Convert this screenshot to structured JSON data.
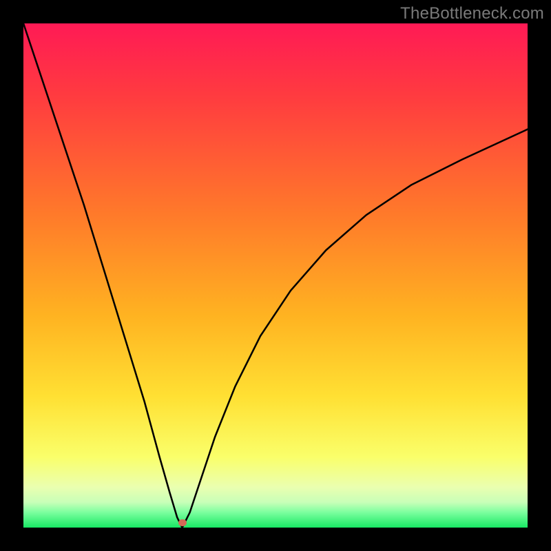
{
  "watermark": "TheBottleneck.com",
  "marker": {
    "x_pct": 31.5,
    "y_pct": 99.0,
    "color": "#d46a57"
  },
  "gradient_stops": [
    {
      "pct": 0,
      "color": "#ff1a55"
    },
    {
      "pct": 14,
      "color": "#ff3a40"
    },
    {
      "pct": 38,
      "color": "#ff7a2a"
    },
    {
      "pct": 58,
      "color": "#ffb321"
    },
    {
      "pct": 74,
      "color": "#ffe033"
    },
    {
      "pct": 86,
      "color": "#faff6a"
    },
    {
      "pct": 92,
      "color": "#eaffb0"
    },
    {
      "pct": 95,
      "color": "#c8ffb8"
    },
    {
      "pct": 97,
      "color": "#7bff9e"
    },
    {
      "pct": 100,
      "color": "#18e864"
    }
  ],
  "chart_data": {
    "type": "line",
    "title": "",
    "xlabel": "",
    "ylabel": "",
    "xlim": [
      0,
      100
    ],
    "ylim": [
      0,
      100
    ],
    "series": [
      {
        "name": "bottleneck-curve",
        "x": [
          0,
          4,
          8,
          12,
          16,
          20,
          24,
          27,
          29,
          30.5,
          31.5,
          33,
          35,
          38,
          42,
          47,
          53,
          60,
          68,
          77,
          87,
          100
        ],
        "values": [
          100,
          88,
          76,
          64,
          51,
          38,
          25,
          14,
          7,
          2,
          0,
          3,
          9,
          18,
          28,
          38,
          47,
          55,
          62,
          68,
          73,
          79
        ]
      }
    ],
    "annotations": [
      {
        "text": "TheBottleneck.com",
        "role": "watermark"
      }
    ],
    "marker_point": {
      "x": 31.5,
      "y": 0
    }
  }
}
